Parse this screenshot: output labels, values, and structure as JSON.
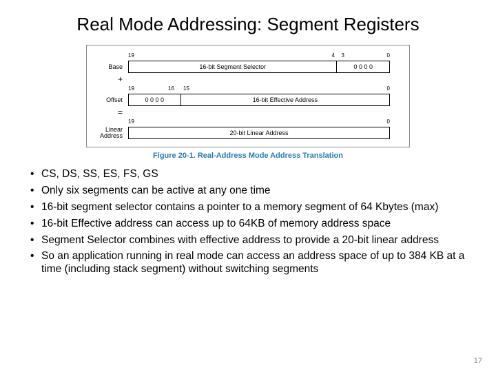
{
  "title": "Real Mode Addressing: Segment Registers",
  "figure": {
    "base": {
      "label": "Base",
      "bits": {
        "hi": "19",
        "mid_hi": "4",
        "mid_lo": "3",
        "lo": "0"
      },
      "seg1": "16-bit Segment Selector",
      "seg2": "0  0  0  0"
    },
    "plus": "+",
    "offset": {
      "label": "Offset",
      "bits": {
        "hi": "19",
        "m1": "16",
        "m2": "15",
        "lo": "0"
      },
      "seg1": "0  0  0  0",
      "seg2": "16-bit Effective Address"
    },
    "equals": "=",
    "linear": {
      "label": "Linear\nAddress",
      "bits": {
        "hi": "19",
        "lo": "0"
      },
      "seg1": "20-bit Linear Address"
    },
    "caption": "Figure 20-1.  Real-Address Mode Address Translation"
  },
  "bullets": [
    "CS, DS, SS, ES, FS, GS",
    "Only six segments can be active at any one time",
    "16-bit segment selector contains a pointer to a memory segment of 64 Kbytes (max)",
    "16-bit Effective address can access up to 64KB of memory address space",
    "Segment Selector combines with effective address to provide a 20-bit linear address",
    "So an application running in real mode can access an address space of up to 384 KB at a time (including stack segment) without switching segments"
  ],
  "page_number": "17"
}
